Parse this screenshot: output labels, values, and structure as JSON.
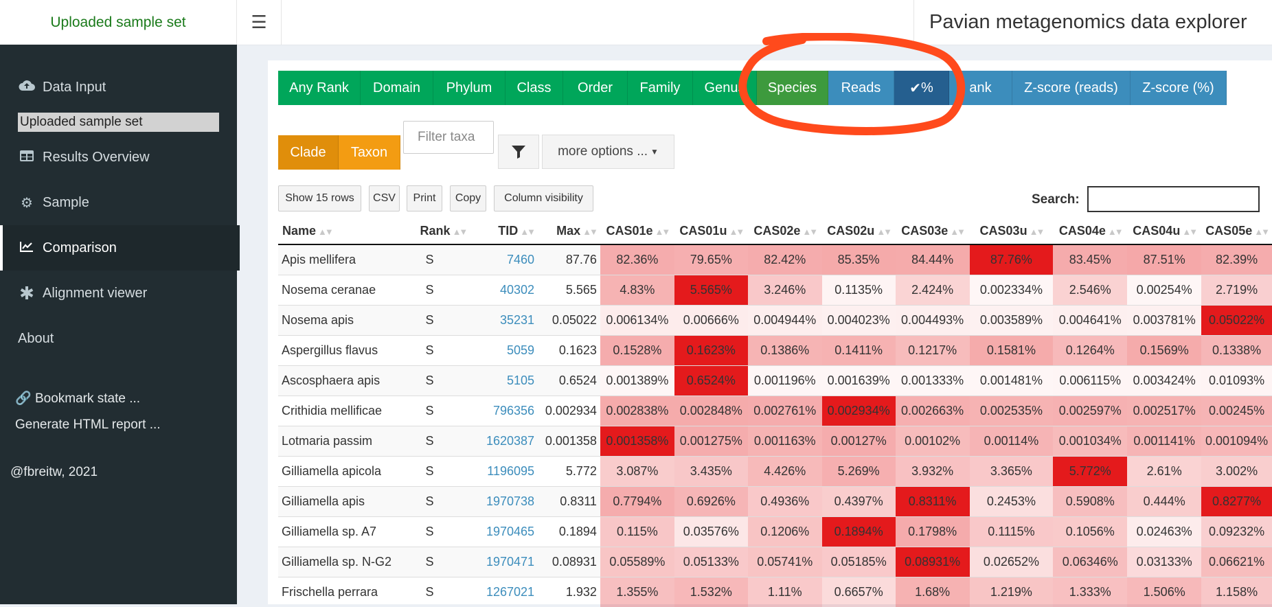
{
  "header": {
    "brand": "Uploaded sample set",
    "toggle_icon": "hamburger-icon",
    "app_title": "Pavian metagenomics data explorer"
  },
  "sidebar": {
    "items": [
      {
        "label": "Data Input",
        "icon": "cloud-upload-icon"
      },
      {
        "label": "Results Overview",
        "icon": "table-icon"
      },
      {
        "label": "Sample",
        "icon": "gear-icon"
      },
      {
        "label": "Comparison",
        "icon": "line-chart-icon",
        "active": true
      },
      {
        "label": "Alignment viewer",
        "icon": "asterisk-icon"
      },
      {
        "label": "About"
      }
    ],
    "sample_set_value": "Uploaded sample set",
    "bookmark_label": "Bookmark state ...",
    "report_label": "Generate HTML report ...",
    "credit": "@fbreitw, 2021"
  },
  "rank_buttons": [
    "Any Rank",
    "Domain",
    "Phylum",
    "Class",
    "Order",
    "Family",
    "Genus",
    "Species"
  ],
  "rank_selected": "Species",
  "value_buttons": [
    "Reads",
    "%",
    "Rank",
    "Z-score (reads)",
    "Z-score (%)"
  ],
  "value_selected": "%",
  "value_selected_marker": "✔",
  "value_rank_visible": "ank",
  "clade_buttons": [
    "Clade",
    "Taxon"
  ],
  "clade_selected": "Clade",
  "filter": {
    "placeholder": "Filter taxa",
    "more_options_label": "more options ..."
  },
  "table_buttons": [
    "Show 15 rows",
    "CSV",
    "Print",
    "Copy",
    "Column visibility"
  ],
  "search_label": "Search:",
  "colors": {
    "highlight_max": "#e41a1c",
    "annotation_circle": "#ff4a1c"
  },
  "table": {
    "columns": [
      "Name",
      "Rank",
      "TID",
      "Max",
      "CAS01e",
      "CAS01u",
      "CAS02e",
      "CAS02u",
      "CAS03e",
      "CAS03u",
      "CAS04e",
      "CAS04u",
      "CAS05e"
    ],
    "rows": [
      {
        "name": "Apis mellifera",
        "rank": "S",
        "tid": "7460",
        "max": "87.76",
        "values": [
          "82.36%",
          "79.65%",
          "82.42%",
          "85.35%",
          "84.44%",
          "87.76%",
          "83.45%",
          "87.51%",
          "82.39%"
        ],
        "fractions": [
          0.938,
          0.908,
          0.939,
          0.973,
          0.962,
          1.0,
          0.951,
          0.997,
          0.939
        ]
      },
      {
        "name": "Nosema ceranae",
        "rank": "S",
        "tid": "40302",
        "max": "5.565",
        "values": [
          "4.83%",
          "5.565%",
          "3.246%",
          "0.1135%",
          "2.424%",
          "0.002334%",
          "2.546%",
          "0.00254%",
          "2.719%"
        ],
        "fractions": [
          0.868,
          1.0,
          0.583,
          0.02,
          0.436,
          0.0,
          0.457,
          0.0,
          0.489
        ]
      },
      {
        "name": "Nosema apis",
        "rank": "S",
        "tid": "35231",
        "max": "0.05022",
        "values": [
          "0.006134%",
          "0.00666%",
          "0.004944%",
          "0.004023%",
          "0.004493%",
          "0.003589%",
          "0.004641%",
          "0.003781%",
          "0.05022%"
        ],
        "fractions": [
          0.12,
          0.13,
          0.1,
          0.08,
          0.09,
          0.07,
          0.09,
          0.075,
          1.0
        ]
      },
      {
        "name": "Aspergillus flavus",
        "rank": "S",
        "tid": "5059",
        "max": "0.1623",
        "values": [
          "0.1528%",
          "0.1623%",
          "0.1386%",
          "0.1411%",
          "0.1217%",
          "0.1581%",
          "0.1264%",
          "0.1569%",
          "0.1338%"
        ],
        "fractions": [
          0.94,
          1.0,
          0.85,
          0.87,
          0.75,
          0.97,
          0.78,
          0.97,
          0.82
        ]
      },
      {
        "name": "Ascosphaera apis",
        "rank": "S",
        "tid": "5105",
        "max": "0.6524",
        "values": [
          "0.001389%",
          "0.6524%",
          "0.001196%",
          "0.001639%",
          "0.001333%",
          "0.001481%",
          "0.006115%",
          "0.003424%",
          "0.01093%"
        ],
        "fractions": [
          0.0,
          1.0,
          0.0,
          0.0,
          0.0,
          0.0,
          0.01,
          0.005,
          0.017
        ]
      },
      {
        "name": "Crithidia mellificae",
        "rank": "S",
        "tid": "796356",
        "max": "0.002934",
        "values": [
          "0.002838%",
          "0.002848%",
          "0.002761%",
          "0.002934%",
          "0.002663%",
          "0.002535%",
          "0.002597%",
          "0.002517%",
          "0.00245%"
        ],
        "fractions": [
          0.97,
          0.97,
          0.94,
          1.0,
          0.91,
          0.86,
          0.89,
          0.86,
          0.84
        ]
      },
      {
        "name": "Lotmaria passim",
        "rank": "S",
        "tid": "1620387",
        "max": "0.001358",
        "values": [
          "0.001358%",
          "0.001275%",
          "0.001163%",
          "0.00127%",
          "0.00102%",
          "0.00114%",
          "0.001034%",
          "0.001141%",
          "0.001094%"
        ],
        "fractions": [
          1.0,
          0.94,
          0.86,
          0.94,
          0.75,
          0.84,
          0.76,
          0.84,
          0.81
        ]
      },
      {
        "name": "Gilliamella apicola",
        "rank": "S",
        "tid": "1196095",
        "max": "5.772",
        "values": [
          "3.087%",
          "3.435%",
          "4.426%",
          "5.269%",
          "3.932%",
          "3.365%",
          "5.772%",
          "2.61%",
          "3.002%"
        ],
        "fractions": [
          0.535,
          0.595,
          0.767,
          0.913,
          0.681,
          0.583,
          1.0,
          0.452,
          0.52
        ]
      },
      {
        "name": "Gilliamella apis",
        "rank": "S",
        "tid": "1970738",
        "max": "0.8311",
        "values": [
          "0.7794%",
          "0.6926%",
          "0.4936%",
          "0.4397%",
          "0.8311%",
          "0.2453%",
          "0.5908%",
          "0.444%",
          "0.8277%"
        ],
        "fractions": [
          0.94,
          0.83,
          0.59,
          0.53,
          1.0,
          0.3,
          0.71,
          0.53,
          1.0
        ]
      },
      {
        "name": "Gilliamella sp. A7",
        "rank": "S",
        "tid": "1970465",
        "max": "0.1894",
        "values": [
          "0.115%",
          "0.03576%",
          "0.1206%",
          "0.1894%",
          "0.1798%",
          "0.1115%",
          "0.1056%",
          "0.02463%",
          "0.09232%"
        ],
        "fractions": [
          0.61,
          0.19,
          0.64,
          1.0,
          0.95,
          0.59,
          0.56,
          0.13,
          0.49
        ]
      },
      {
        "name": "Gilliamella sp. N-G2",
        "rank": "S",
        "tid": "1970471",
        "max": "0.08931",
        "values": [
          "0.05589%",
          "0.05133%",
          "0.05741%",
          "0.05185%",
          "0.08931%",
          "0.02652%",
          "0.06346%",
          "0.03133%",
          "0.06621%"
        ],
        "fractions": [
          0.63,
          0.57,
          0.64,
          0.58,
          1.0,
          0.3,
          0.71,
          0.35,
          0.74
        ]
      },
      {
        "name": "Frischella perrara",
        "rank": "S",
        "tid": "1267021",
        "max": "1.932",
        "values": [
          "1.355%",
          "1.532%",
          "1.11%",
          "0.6657%",
          "1.68%",
          "1.219%",
          "1.333%",
          "1.506%",
          "1.158%"
        ],
        "fractions": [
          0.7,
          0.79,
          0.57,
          0.34,
          0.87,
          0.63,
          0.69,
          0.78,
          0.6
        ]
      }
    ]
  }
}
